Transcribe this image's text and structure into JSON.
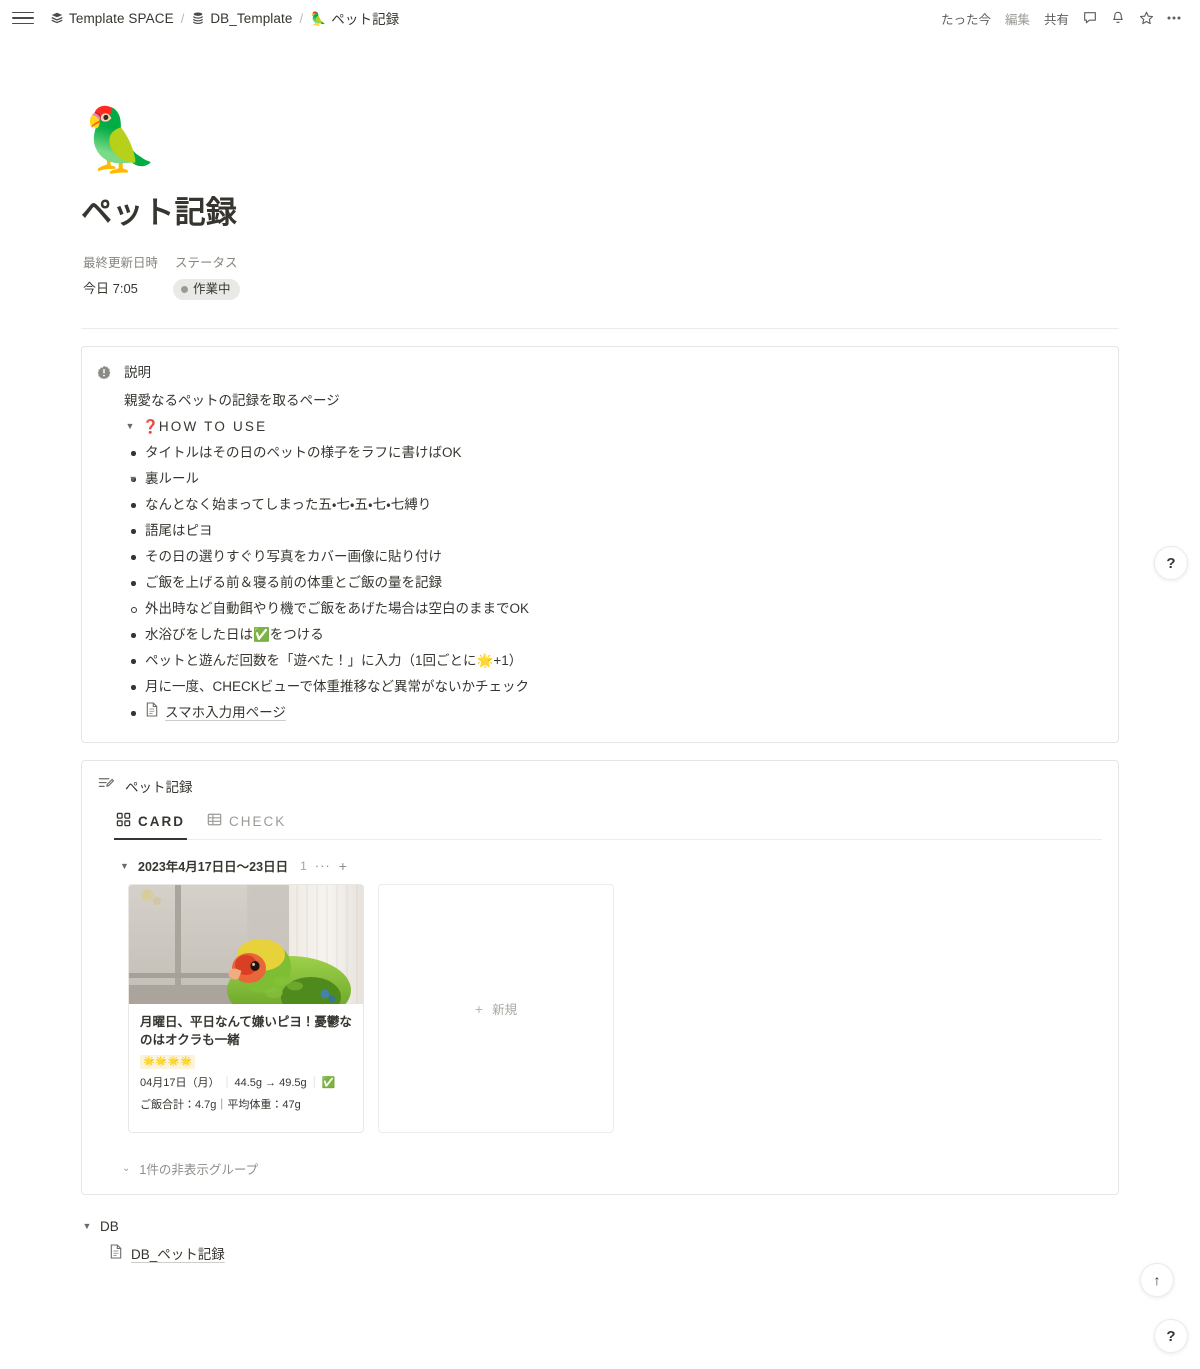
{
  "topbar": {
    "menu_icon": "hamburger-icon",
    "breadcrumbs": [
      {
        "icon": "stack-icon",
        "label": "Template SPACE"
      },
      {
        "icon": "database-icon",
        "label": "DB_Template"
      },
      {
        "icon": "parrot-emoji",
        "emoji": "🦜",
        "label": "ペット記録"
      }
    ],
    "separator": "/",
    "edited_time": "たった今",
    "edited_label": "編集",
    "share_label": "共有",
    "icons": [
      "comment-icon",
      "bell-icon",
      "star-icon",
      "more-icon"
    ]
  },
  "page": {
    "emoji": "🦜",
    "title": "ペット記録",
    "properties": [
      {
        "name": "最終更新日時",
        "value": "今日 7:05",
        "type": "text"
      },
      {
        "name": "ステータス",
        "value": "作業中",
        "type": "status"
      }
    ]
  },
  "callout": {
    "icon": "info-badge-icon",
    "title": "説明",
    "paragraph": "親愛なるペットの記録を取るページ",
    "toggle": {
      "marker": "❓",
      "label": "HOW TO USE",
      "items": [
        {
          "level": 1,
          "kind": "bullet",
          "text": "タイトルはその日のペットの様子をラフに書けばOK"
        },
        {
          "level": 1,
          "kind": "toggle",
          "text": "裏ルール"
        },
        {
          "level": 2,
          "kind": "bullet",
          "text": "なんとなく始まってしまった五・七・五・七・七縛り"
        },
        {
          "level": 2,
          "kind": "bullet",
          "text": "語尾はピヨ"
        },
        {
          "level": 1,
          "kind": "bullet",
          "text": "その日の選りすぐり写真をカバー画像に貼り付け"
        },
        {
          "level": 1,
          "kind": "bullet",
          "text": "ご飯を上げる前＆寝る前の体重とご飯の量を記録"
        },
        {
          "level": 2,
          "kind": "hollow",
          "text": "外出時など自動餌やり機でご飯をあげた場合は空白のままでOK"
        },
        {
          "level": 1,
          "kind": "bullet",
          "text": "水浴びをした日は✅をつける"
        },
        {
          "level": 1,
          "kind": "bullet",
          "text": "ペットと遊んだ回数を「遊べた！」に入力（1回ごとに🌟+1）"
        },
        {
          "level": 1,
          "kind": "bullet",
          "text": "月に一度、CHECKビューで体重推移など異常がないかチェック"
        },
        {
          "level": 1,
          "kind": "page-link",
          "text": "スマホ入力用ページ"
        }
      ]
    }
  },
  "database": {
    "icon": "list-edit-icon",
    "title": "ペット記録",
    "tabs": [
      {
        "icon": "gallery-icon",
        "label": "CARD",
        "active": true
      },
      {
        "icon": "table-icon",
        "label": "CHECK",
        "active": false
      }
    ],
    "group": {
      "name": "2023年4月17日日〜23日日",
      "count": "1",
      "more": "···",
      "add": "+"
    },
    "cards": [
      {
        "image": "lovebird-by-window-photo",
        "title": "月曜日、平日なんて嫌いピヨ！憂鬱なのはオクラも一緒",
        "stars": "🌟🌟🌟🌟",
        "meta_line1_date": "04月17日（月）",
        "meta_line1_weight": "44.5g → 49.5g",
        "meta_line1_check": "✅",
        "meta_line2": "ご飯合計：4.7g｜平均体重：47g"
      }
    ],
    "new_card_label": "新規",
    "new_card_plus": "+",
    "hidden_group_label": "1件の非表示グループ"
  },
  "db_toggle": {
    "label": "DB",
    "child_icon": "page-icon",
    "child_label": "DB_ペット記録"
  },
  "floating": {
    "help_mid": "?",
    "scroll_top": "↑",
    "help_bottom": "?"
  }
}
